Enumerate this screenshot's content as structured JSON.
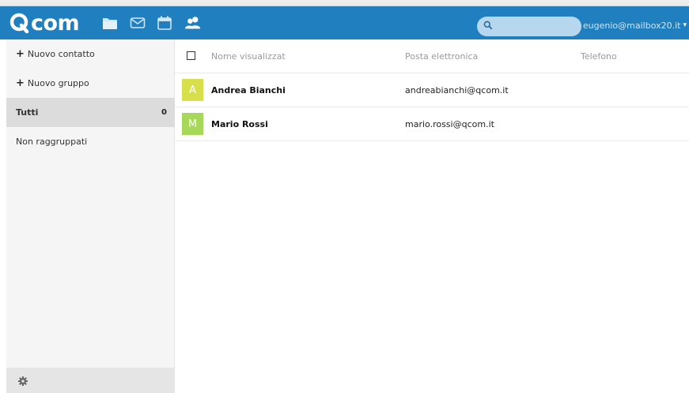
{
  "header": {
    "logo_text": "com",
    "search_placeholder": "",
    "user_label": "eugenio@mailbox20.it",
    "user_caret": "▾",
    "apps": [
      {
        "name": "files-icon"
      },
      {
        "name": "mail-icon"
      },
      {
        "name": "calendar-icon"
      },
      {
        "name": "contacts-icon"
      }
    ]
  },
  "sidebar": {
    "new_contact_plus": "+",
    "new_contact_label": "Nuovo contatto",
    "new_group_plus": "+",
    "new_group_label": "Nuovo gruppo",
    "all_label": "Tutti",
    "all_count": "0",
    "ungrouped_label": "Non raggruppati"
  },
  "list": {
    "columns": {
      "name": "Nome visualizzat",
      "email": "Posta elettronica",
      "phone": "Telefono"
    },
    "rows": [
      {
        "initial": "A",
        "name": "Andrea Bianchi",
        "email": "andreabianchi@qcom.it",
        "phone": "",
        "avatar_color": "#d7e04a"
      },
      {
        "initial": "M",
        "name": "Mario Rossi",
        "email": "mario.rossi@qcom.it",
        "phone": "",
        "avatar_color": "#a8d85a"
      }
    ]
  },
  "colors": {
    "header_bg": "#1f7fbf",
    "sidebar_bg": "#f5f5f5",
    "active_item_bg": "#dcdcdc"
  }
}
